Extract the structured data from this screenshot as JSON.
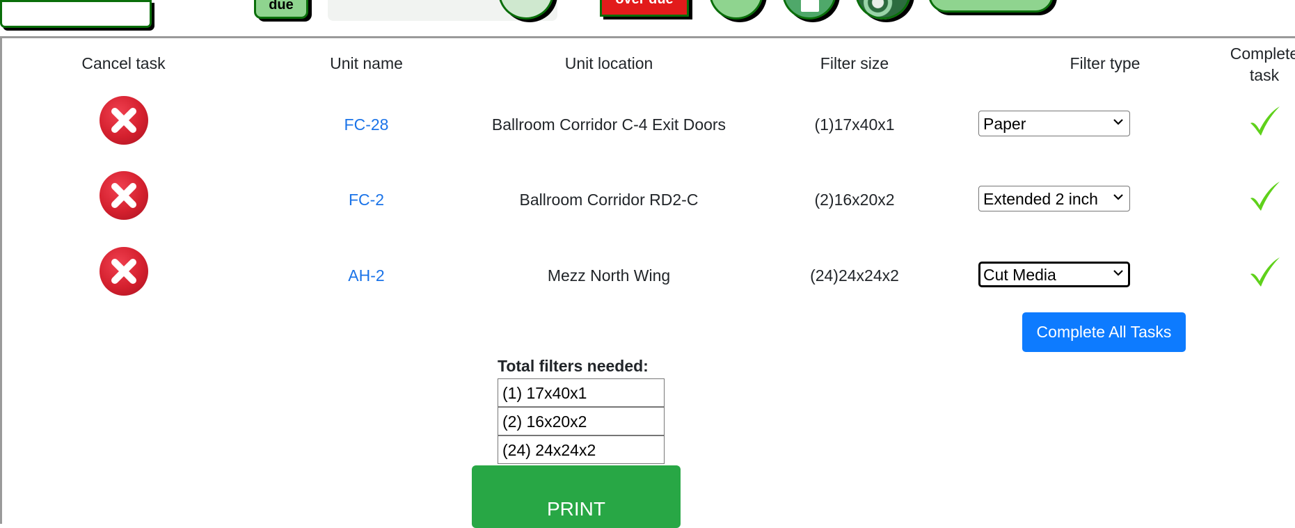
{
  "toolbar": {
    "due_label": "due",
    "overdue_label": "over due"
  },
  "table": {
    "headers": {
      "cancel": "Cancel task",
      "unit_name": "Unit name",
      "unit_location": "Unit location",
      "filter_size": "Filter size",
      "filter_type": "Filter type",
      "complete_line1": "Complete",
      "complete_line2": "task"
    },
    "rows": [
      {
        "unit_name": "FC-28",
        "unit_location": "Ballroom Corridor C-4 Exit Doors",
        "filter_size": "(1)17x40x1",
        "filter_type": "Paper"
      },
      {
        "unit_name": "FC-2",
        "unit_location": "Ballroom Corridor RD2-C",
        "filter_size": "(2)16x20x2",
        "filter_type": "Extended 2 inch"
      },
      {
        "unit_name": "AH-2",
        "unit_location": "Mezz North Wing",
        "filter_size": "(24)24x24x2",
        "filter_type": "Cut Media"
      }
    ]
  },
  "complete_all_label": "Complete All Tasks",
  "totals": {
    "label": "Total filters needed:",
    "items": [
      "(1) 17x40x1",
      "(2) 16x20x2",
      "(24) 24x24x2"
    ]
  },
  "print_label": "PRINT",
  "colors": {
    "link": "#1a73e8",
    "primary": "#0d7bff",
    "success": "#28a745",
    "danger": "#d4202e",
    "check": "#5fd11b"
  }
}
